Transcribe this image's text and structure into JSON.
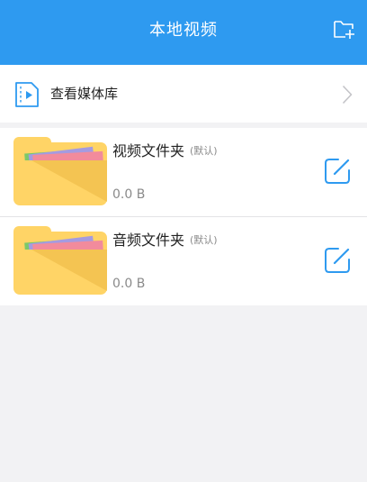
{
  "header": {
    "title": "本地视频",
    "new_folder_icon": "folder-plus-icon"
  },
  "media_library": {
    "label": "查看媒体库",
    "icon": "video-file-icon"
  },
  "folders": [
    {
      "name": "视频文件夹",
      "default_tag": "(默认)",
      "size": "0.0 B"
    },
    {
      "name": "音频文件夹",
      "default_tag": "(默认)",
      "size": "0.0 B"
    }
  ],
  "colors": {
    "header_bg": "#2e9af0",
    "accent": "#2e9af0",
    "folder": "#ffd466",
    "background": "#f2f2f4"
  }
}
